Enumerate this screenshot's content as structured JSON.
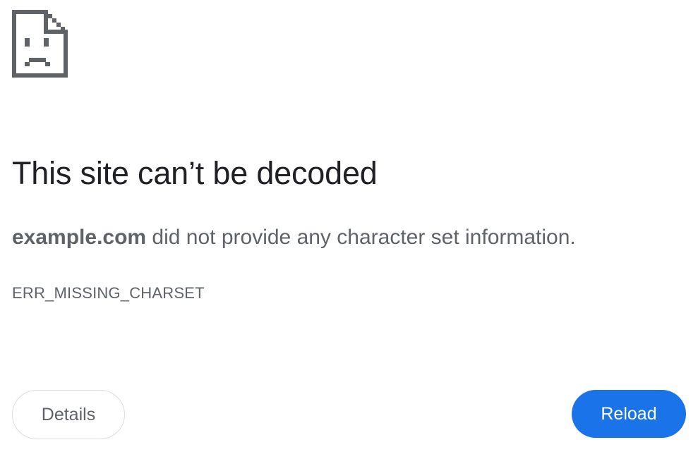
{
  "icon": "sad-page-icon",
  "heading": "This site can’t be decoded",
  "summary": {
    "host": "example.com",
    "message": " did not provide any character set information."
  },
  "error_code": "ERR_MISSING_CHARSET",
  "buttons": {
    "details_label": "Details",
    "reload_label": "Reload"
  },
  "colors": {
    "accent": "#1a73e8",
    "heading": "#202124",
    "body_text": "#5f6368",
    "icon": "#5f6368",
    "button_border": "#dadce0"
  }
}
